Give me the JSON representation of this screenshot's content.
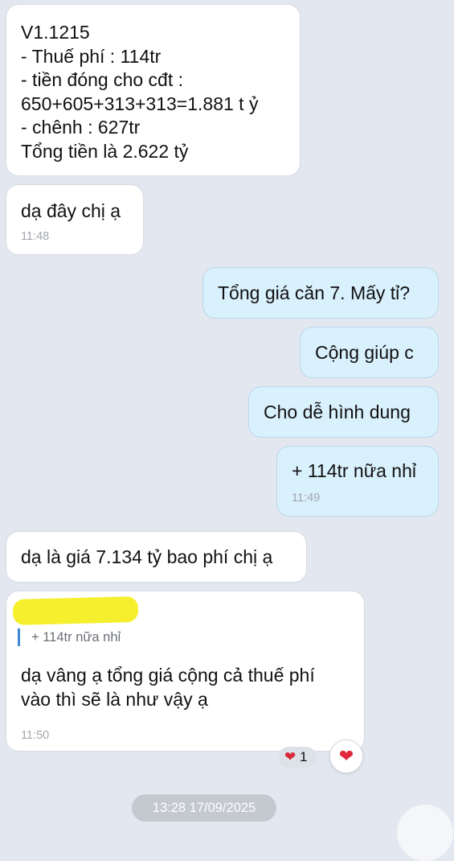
{
  "messages": [
    {
      "id": "m1",
      "direction": "in",
      "lines": [
        "V1.1215",
        "- Thuế phí : 114tr",
        "- tiền đóng cho cđt :",
        "650+605+313+313=1.881 t ỷ",
        "- chênh : 627tr",
        "Tổng tiền là 2.622 tỷ"
      ]
    },
    {
      "id": "m2",
      "direction": "in",
      "lines": [
        "dạ đây chị ạ"
      ],
      "time": "11:48"
    },
    {
      "id": "m3",
      "direction": "out",
      "lines": [
        "Tổng giá căn 7. Mấy tỉ?"
      ]
    },
    {
      "id": "m4",
      "direction": "out",
      "lines": [
        "Cộng giúp c"
      ]
    },
    {
      "id": "m5",
      "direction": "out",
      "lines": [
        "Cho dễ hình dung"
      ]
    },
    {
      "id": "m6",
      "direction": "out",
      "lines": [
        "+ 114tr nữa nhỉ"
      ],
      "time": "11:49"
    },
    {
      "id": "m7",
      "direction": "in",
      "lines": [
        "dạ là giá 7.134 tỷ bao phí chị ạ"
      ]
    },
    {
      "id": "m8",
      "direction": "in",
      "quoted": "+ 114tr nữa nhỉ",
      "lines": [
        "dạ vâng ạ tổng giá cộng cả thuế phí",
        "vào thì sẽ là như vậy ạ"
      ],
      "time": "11:50"
    }
  ],
  "reaction": {
    "icon": "heart-icon",
    "count": "1"
  },
  "date_divider": "13:28 17/09/2025",
  "colors": {
    "background": "#e3e7ef",
    "incoming": "#ffffff",
    "outgoing": "#d9f0fd",
    "quote_bar": "#3d87d6",
    "heart": "#e0283b"
  }
}
